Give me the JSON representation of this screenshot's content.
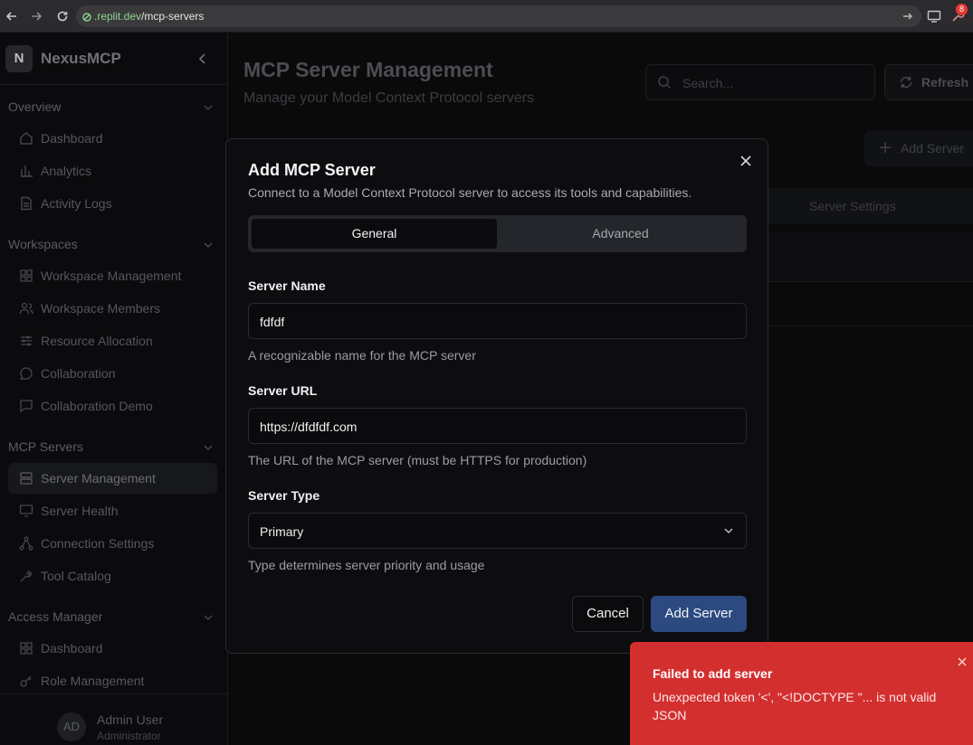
{
  "browser": {
    "url_host": ".replit.dev",
    "url_path": "/mcp-servers",
    "extension_badge": "8"
  },
  "sidebar": {
    "brand_letter": "N",
    "brand_name": "NexusMCP",
    "sections": [
      {
        "title": "Overview",
        "items": [
          "Dashboard",
          "Analytics",
          "Activity Logs"
        ]
      },
      {
        "title": "Workspaces",
        "items": [
          "Workspace Management",
          "Workspace Members",
          "Resource Allocation",
          "Collaboration",
          "Collaboration Demo"
        ]
      },
      {
        "title": "MCP Servers",
        "items": [
          "Server Management",
          "Server Health",
          "Connection Settings",
          "Tool Catalog"
        ]
      },
      {
        "title": "Access Manager",
        "items": [
          "Dashboard",
          "Role Management"
        ]
      }
    ],
    "user": {
      "initials": "AD",
      "name": "Admin User",
      "role": "Administrator"
    }
  },
  "main": {
    "title": "MCP Server Management",
    "subtitle": "Manage your Model Context Protocol servers",
    "search_placeholder": "Search...",
    "refresh_label": "Refresh",
    "add_server_label": "Add Server",
    "tab_label": "Server Settings"
  },
  "modal": {
    "title": "Add MCP Server",
    "description": "Connect to a Model Context Protocol server to access its tools and capabilities.",
    "tabs": [
      "General",
      "Advanced"
    ],
    "server_name_label": "Server Name",
    "server_name_value": "fdfdf",
    "server_name_hint": "A recognizable name for the MCP server",
    "server_url_label": "Server URL",
    "server_url_value": "https://dfdfdf.com",
    "server_url_hint": "The URL of the MCP server (must be HTTPS for production)",
    "server_type_label": "Server Type",
    "server_type_value": "Primary",
    "server_type_hint": "Type determines server priority and usage",
    "cancel_label": "Cancel",
    "submit_label": "Add Server"
  },
  "toast": {
    "title": "Failed to add server",
    "message": "Unexpected token '<', \"<!DOCTYPE \"... is not valid JSON",
    "color": "#d32f2f"
  }
}
